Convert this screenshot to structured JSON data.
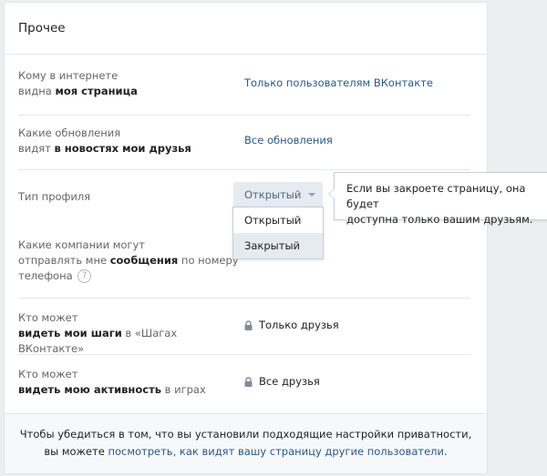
{
  "section": {
    "title": "Прочее"
  },
  "rows": [
    {
      "label_plain": "Кому в интернете",
      "label_line2_plain": "видна ",
      "label_bold": "моя страница",
      "value": "Только пользователям ВКонтакте"
    },
    {
      "label_plain": "Какие обновления",
      "label_line2_plain": "видят ",
      "label_bold": "в новостях мои друзья",
      "value": "Все обновления"
    },
    {
      "label": "Тип профиля",
      "value": "Открытый"
    },
    {
      "label_plain_1": "Какие компании могут",
      "label_plain_2": "отправлять мне ",
      "label_bold": "сообщения",
      "label_plain_3": " по номеру",
      "label_plain_4": "телефона",
      "help": "?"
    },
    {
      "label_plain": "Кто может",
      "label_bold": "видеть мои шаги",
      "label_plain_2": " в «Шагах ВКонтакте»",
      "value": "Только друзья",
      "icon": "lock-icon"
    },
    {
      "label_plain": "Кто может",
      "label_bold": "видеть мою активность",
      "label_plain_2": " в играх",
      "value": "Все друзья",
      "icon": "lock-icon"
    }
  ],
  "dropdown": {
    "selected": "Открытый",
    "options": [
      "Открытый",
      "Закрытый"
    ],
    "highlighted": "Закрытый"
  },
  "tooltip": {
    "text_line1": "Если вы закроете страницу, она будет",
    "text_line2": "доступна только вашим друзьям."
  },
  "footer": {
    "text_line1": "Чтобы убедиться в том, что вы установили подходящие настройки приватности,",
    "text_line2_plain": "вы можете ",
    "link": "посмотреть, как видят вашу страницу другие пользователи",
    "text_end": "."
  },
  "colors": {
    "link": "#2a5885",
    "background": "#edeef0",
    "highlight": "#e5ebf1"
  }
}
